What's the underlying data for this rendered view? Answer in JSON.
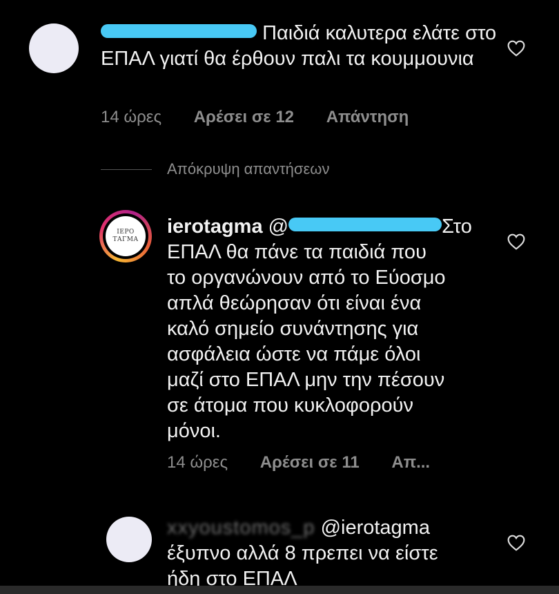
{
  "comments": [
    {
      "text": "Παιδιά καλυτερα ελάτε στο ΕΠΑΛ γιατί θα έρθουν παλι τα κουμμουνια",
      "time": "14 ώρες",
      "likes": "Αρέσει σε 12",
      "reply": "Απάντηση"
    },
    {
      "username": "ierotagma",
      "mention_prefix": "@",
      "text": "Στο ΕΠΑΛ θα πάνε τα παιδιά που το οργανώνουν από το Εύοσμο απλά θεώρησαν ότι είναι ένα καλό σημείο συνάντησης για ασφάλεια ώστε να πάμε όλοι μαζί στο ΕΠΑΛ μην την πέσουν σε άτομα που κυκλοφορούν μόνοι.",
      "line1": "Στο",
      "lines": [
        "ΕΠΑΛ θα πάνε τα παιδιά που",
        "το οργανώνουν από το Εύοσμο",
        "απλά θεώρησαν ότι είναι ένα",
        "καλό σημείο συνάντησης για",
        "ασφάλεια ώστε να πάμε όλοι",
        "μαζί στο ΕΠΑΛ μην την πέσουν",
        "σε άτομα που κυκλοφορούν",
        "μόνοι."
      ],
      "avatar_logo_line1": "ΙΕΡΟ",
      "avatar_logo_line2": "ΤΑΓΜΑ",
      "time": "14 ώρες",
      "likes": "Αρέσει σε 11",
      "reply": "Απ..."
    },
    {
      "username_blurred": "xxyoustomos_p",
      "mention": "@ierotagma",
      "line1": "έξυπνο αλλά 8 πρεπει να είστε",
      "line2": "ήδη στο ΕΠΑΛ"
    }
  ],
  "hide_replies": "Απόκρυψη απαντήσεων",
  "colors": {
    "background": "#000000",
    "text": "#f2f2f2",
    "meta": "#8e8e8e",
    "redaction": "#48c9f5"
  },
  "icons": {
    "like": "heart-outline-icon"
  }
}
